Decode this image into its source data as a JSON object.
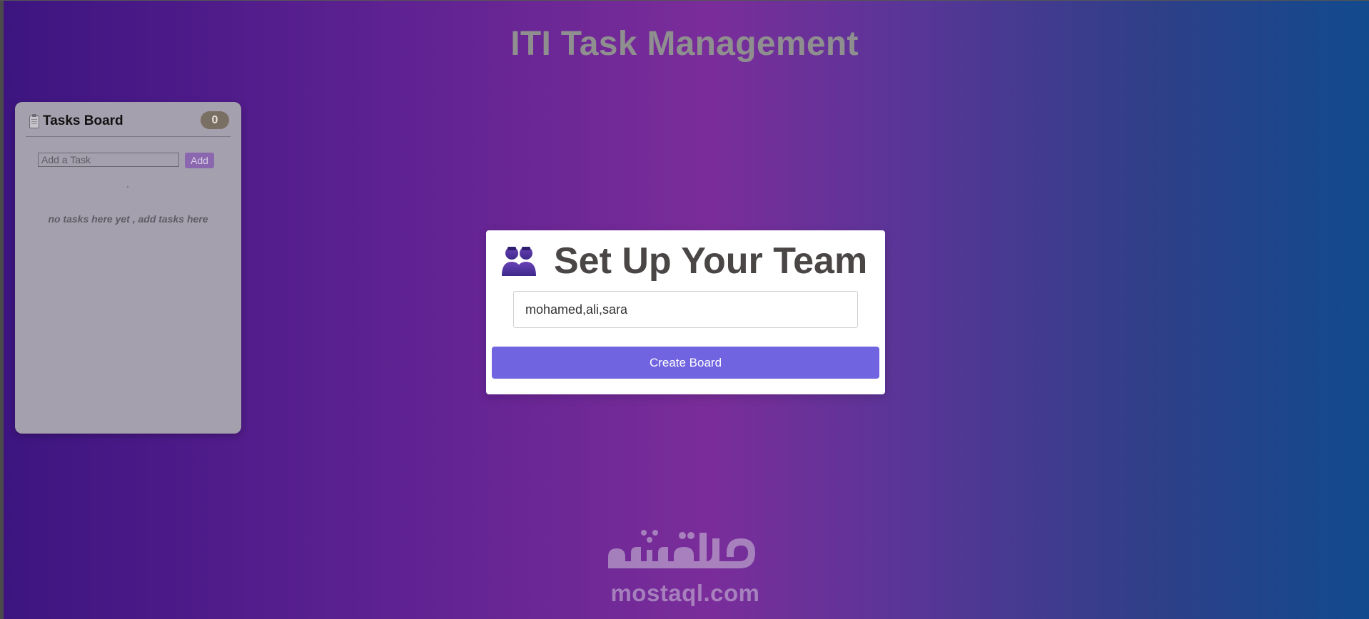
{
  "app": {
    "title": "ITI Task Management"
  },
  "board": {
    "title": "Tasks Board",
    "task_count": "0",
    "input_placeholder": "Add a Task",
    "add_label": "Add",
    "empty_message": "no tasks here yet , add tasks here"
  },
  "setup": {
    "title": "Set Up Your Team",
    "icon": "team-icon",
    "team_input_value": "mohamed,ali,sara",
    "create_label": "Create Board"
  },
  "watermark": {
    "arabic_text": "مستقل",
    "latin_text": "mostaql.com"
  },
  "colors": {
    "primary_button": "#7064e0",
    "add_button": "#8b67b0",
    "badge": "#7a6f63",
    "board_background": "#a5a0ad",
    "title_text": "#8f8f8f"
  }
}
